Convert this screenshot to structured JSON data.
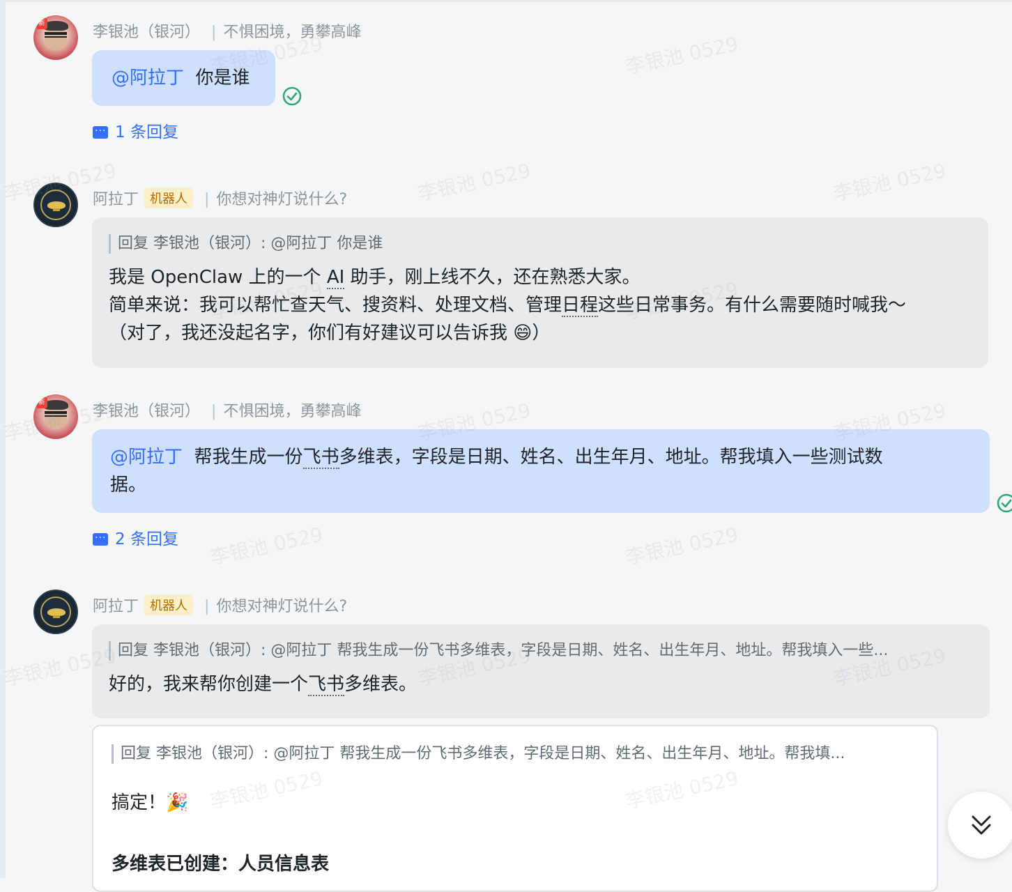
{
  "watermark": "李银池 0529",
  "messages": [
    {
      "sender": "李银池（银河）",
      "status": "不惧困境，勇攀高峰",
      "mention": "@阿拉丁",
      "text": "你是谁",
      "replies": "1 条回复"
    },
    {
      "sender": "阿拉丁",
      "badge": "机器人",
      "status": "你想对神灯说什么?",
      "quote": "回复 李银池（银河）: @阿拉丁 你是谁",
      "line1_a": "我是 OpenClaw 上的一个 ",
      "line1_ai": "AI",
      "line1_b": " 助手，刚上线不久，还在熟悉大家。",
      "line2_a": "简单来说：我可以帮忙查天气、搜资料、处理文档、管理",
      "line2_term": "日程",
      "line2_b": "这些日常事务。有什么需要随时喊我～",
      "line3": "（对了，我还没起名字，你们有好建议可以告诉我 😄）"
    },
    {
      "sender": "李银池（银河）",
      "status": "不惧困境，勇攀高峰",
      "mention": "@阿拉丁",
      "text_a": "帮我生成一份",
      "text_term": "飞书",
      "text_b": "多维表，字段是日期、姓名、出生年月、地址。帮我填入一些测试数",
      "text_c": "据。",
      "replies": "2 条回复"
    },
    {
      "sender": "阿拉丁",
      "badge": "机器人",
      "status": "你想对神灯说什么?",
      "quote": "回复 李银池（银河）: @阿拉丁 帮我生成一份飞书多维表，字段是日期、姓名、出生年月、地址。帮我填入一些...",
      "text_a": "好的，我来帮你创建一个",
      "text_term": "飞书",
      "text_b": "多维表。"
    }
  ],
  "card": {
    "quote": "回复 李银池（银河）: @阿拉丁 帮我生成一份飞书多维表，字段是日期、姓名、出生年月、地址。帮我填...",
    "line1": "搞定！🎉",
    "heading": "多维表已创建：人员信息表"
  },
  "colors": {
    "accent": "#3370ff",
    "user_bubble": "#cfe0fe",
    "bot_bubble": "#e9eaec",
    "read_check": "#2ea87a",
    "bot_badge_bg": "#fcf0c9"
  },
  "icons": [
    "read-check-icon",
    "reply-thread-icon",
    "scroll-to-bottom-icon"
  ]
}
